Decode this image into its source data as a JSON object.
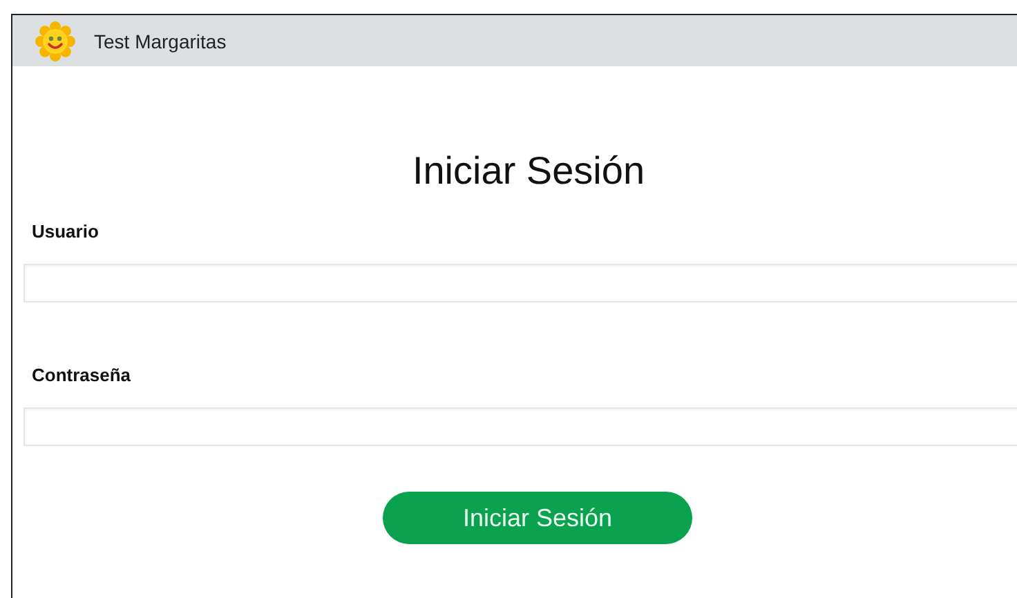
{
  "app_bar": {
    "title": "Test Margaritas"
  },
  "heading": "Iniciar Sesión",
  "fields": [
    {
      "label": "Usuario"
    },
    {
      "label": "Contraseña"
    }
  ],
  "button": {
    "label": "Iniciar Sesión"
  }
}
